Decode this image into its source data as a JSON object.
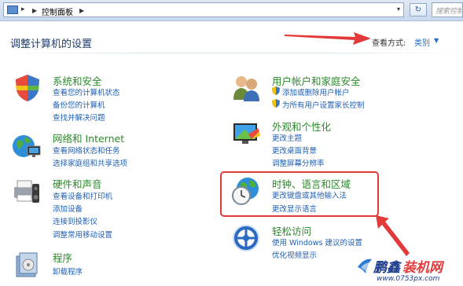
{
  "address_bar": {
    "breadcrumb": "控制面板",
    "search_placeholder": "搜索控制"
  },
  "header": {
    "title": "调整计算机的设置",
    "view_by_label": "查看方式:",
    "view_by_value": "类别"
  },
  "categories": [
    {
      "title": "系统和安全",
      "links": [
        "查看您的计算机状态",
        "备份您的计算机",
        "查找并解决问题"
      ],
      "icon": "system-security-icon"
    },
    {
      "title": "网络和 Internet",
      "links": [
        "查看网络状态和任务",
        "选择家庭组和共享选项"
      ],
      "icon": "network-icon"
    },
    {
      "title": "硬件和声音",
      "links": [
        "查看设备和打印机",
        "添加设备",
        "连接到投影仪",
        "调整常用移动设置"
      ],
      "icon": "hardware-sound-icon"
    },
    {
      "title": "程序",
      "links": [
        "卸载程序"
      ],
      "icon": "programs-icon"
    },
    {
      "title": "用户帐户和家庭安全",
      "links": [
        "添加或删除用户帐户",
        "为所有用户设置家长控制"
      ],
      "icon": "user-accounts-icon"
    },
    {
      "title": "外观和个性化",
      "links": [
        "更改主题",
        "更改桌面背景",
        "调整屏幕分辨率"
      ],
      "icon": "appearance-icon"
    },
    {
      "title": "时钟、语言和区域",
      "links": [
        "更改键盘或其他输入法",
        "更改显示语言"
      ],
      "icon": "clock-globe-icon"
    },
    {
      "title": "轻松访问",
      "links": [
        "使用 Windows 建议的设置",
        "优化视频显示"
      ],
      "icon": "ease-of-access-icon"
    }
  ],
  "watermark": {
    "name_dark": "鹏鑫",
    "name_red": "装机网",
    "url": "www.0753px.com"
  },
  "colors": {
    "category_title": "#2a8a2a",
    "link": "#1e5fb4",
    "highlight": "#e23a3a"
  }
}
